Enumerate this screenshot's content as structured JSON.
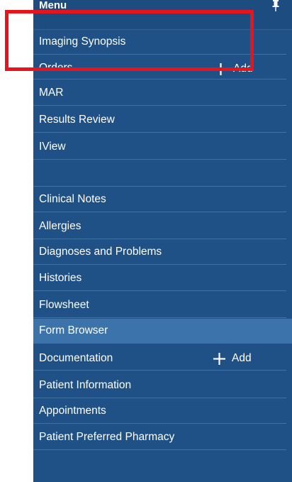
{
  "menu": {
    "title": "Menu",
    "pin_icon": "pin-icon"
  },
  "items": [
    {
      "label": "Imaging Synopsis"
    },
    {
      "label": "Orders",
      "add_label": "Add"
    },
    {
      "label": "MAR"
    },
    {
      "label": "Results Review"
    },
    {
      "label": "IView"
    },
    {
      "label": ""
    },
    {
      "label": "Clinical Notes"
    },
    {
      "label": "Allergies"
    },
    {
      "label": "Diagnoses and Problems"
    },
    {
      "label": "Histories"
    },
    {
      "label": "Flowsheet"
    },
    {
      "label": "Form Browser",
      "selected": true
    },
    {
      "label": "Documentation",
      "add_label": "Add"
    },
    {
      "label": "Patient Information"
    },
    {
      "label": "Appointments"
    },
    {
      "label": "Patient Preferred Pharmacy"
    }
  ],
  "colors": {
    "panel_bg": "#1f5186",
    "selected_bg": "#3b73aa",
    "highlight_border": "#e8141c",
    "text": "#ffffff"
  }
}
